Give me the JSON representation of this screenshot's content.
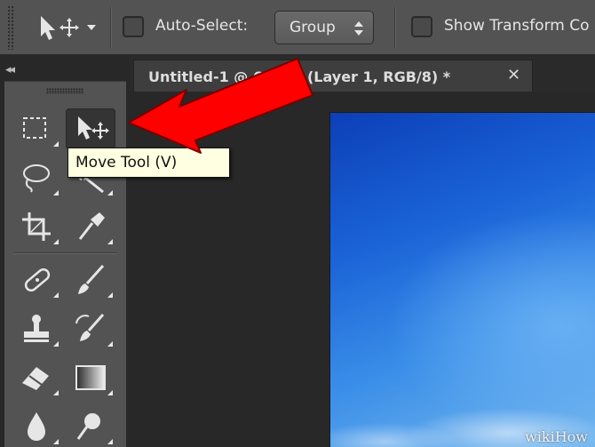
{
  "options_bar": {
    "auto_select_label": "Auto-Select:",
    "auto_select_checked": false,
    "group_select_value": "Group",
    "show_transform_label": "Show Transform Co",
    "show_transform_checked": false
  },
  "toolbar": {
    "collapse_glyph": "◂◂",
    "tools": [
      {
        "id": "marquee",
        "icon": "rect-marquee-icon"
      },
      {
        "id": "move",
        "icon": "move-tool-icon",
        "active": true
      },
      {
        "id": "lasso",
        "icon": "lasso-icon"
      },
      {
        "id": "quick-select",
        "icon": "quick-selection-icon"
      },
      {
        "id": "crop",
        "icon": "crop-icon"
      },
      {
        "id": "eyedropper",
        "icon": "eyedropper-icon"
      },
      {
        "id": "healing",
        "icon": "healing-brush-icon"
      },
      {
        "id": "brush",
        "icon": "brush-icon"
      },
      {
        "id": "stamp",
        "icon": "clone-stamp-icon"
      },
      {
        "id": "history-brush",
        "icon": "history-brush-icon"
      },
      {
        "id": "eraser",
        "icon": "eraser-icon"
      },
      {
        "id": "gradient",
        "icon": "gradient-icon"
      },
      {
        "id": "blur",
        "icon": "blur-icon"
      },
      {
        "id": "dodge",
        "icon": "dodge-icon"
      }
    ]
  },
  "document": {
    "tab_title": "Untitled-1 @ 66.7% (Layer 1, RGB/8) *",
    "close_glyph": "✕"
  },
  "tooltip": {
    "text": "Move Tool (V)"
  },
  "annotation": {
    "arrow_color": "#ff0000"
  },
  "watermark": {
    "text": "wikiHow"
  },
  "colors": {
    "ui_panel": "#535353",
    "ui_dark": "#282828",
    "tooltip_bg": "#ffffe1",
    "canvas_blue": "#1b64d8"
  }
}
